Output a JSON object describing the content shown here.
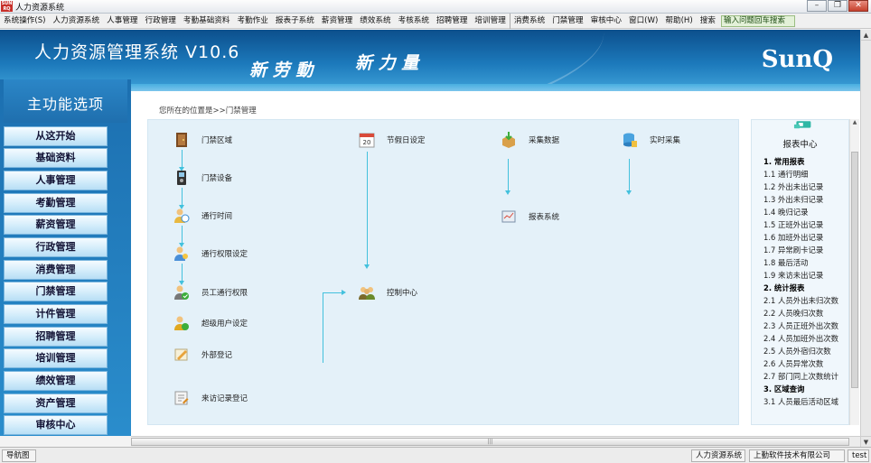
{
  "window": {
    "title": "人力资源系统",
    "icon_text": "SUN RQ"
  },
  "menu": [
    "系统操作(S)",
    "人力资源系统",
    "人事管理",
    "行政管理",
    "考勤基础资料",
    "考勤作业",
    "报表子系统",
    "薪资管理",
    "绩效系统",
    "考核系统",
    "招聘管理",
    "培训管理",
    "消费系统",
    "门禁管理",
    "审核中心",
    "窗口(W)",
    "帮助(H)",
    "搜索"
  ],
  "search": {
    "value": "输入问题回车搜索"
  },
  "banner": {
    "title": "人力资源管理系统 V10.6",
    "slogan1": "新 劳 動",
    "slogan2": "新 力 量",
    "brand": "SunQ"
  },
  "sidebar": {
    "title": "主功能选项",
    "items": [
      "从这开始",
      "基础资料",
      "人事管理",
      "考勤管理",
      "薪资管理",
      "行政管理",
      "消费管理",
      "门禁管理",
      "计件管理",
      "招聘管理",
      "培训管理",
      "绩效管理",
      "资产管理",
      "审核中心"
    ]
  },
  "breadcrumb": "您所在的位置是>>门禁管理",
  "modules": {
    "door_area": "门禁区域",
    "door_device": "门禁设备",
    "pass_time": "通行时间",
    "pass_permission": "通行权限设定",
    "employee_permission": "员工通行权限",
    "super_user": "超级用户设定",
    "visitor_register": "外部登记",
    "visit_record": "来访记录登记",
    "holiday": "节假日设定",
    "control_center": "控制中心",
    "collect_data": "采集数据",
    "report_system": "报表系统",
    "realtime_collect": "实时采集"
  },
  "report_center": {
    "title": "报表中心",
    "items": [
      {
        "text": "1. 常用报表",
        "section": true
      },
      {
        "text": "1.1 通行明细",
        "section": false
      },
      {
        "text": "1.2 外出未出记录",
        "section": false
      },
      {
        "text": "1.3 外出未归记录",
        "section": false
      },
      {
        "text": "1.4 晚归记录",
        "section": false
      },
      {
        "text": "1.5 正班外出记录",
        "section": false
      },
      {
        "text": "1.6 加班外出记录",
        "section": false
      },
      {
        "text": "1.7 异常刷卡记录",
        "section": false
      },
      {
        "text": "1.8 最后活动",
        "section": false
      },
      {
        "text": "1.9 来访未出记录",
        "section": false
      },
      {
        "text": "2. 统计报表",
        "section": true
      },
      {
        "text": "2.1 人员外出未归次数",
        "section": false
      },
      {
        "text": "2.2 人员晚归次数",
        "section": false
      },
      {
        "text": "2.3 人员正班外出次数",
        "section": false
      },
      {
        "text": "2.4 人员加班外出次数",
        "section": false
      },
      {
        "text": "2.5 人员外宿归次数",
        "section": false
      },
      {
        "text": "2.6 人员异常次数",
        "section": false
      },
      {
        "text": "2.7 部门同上次数统计",
        "section": false
      },
      {
        "text": "3. 区域查询",
        "section": true
      },
      {
        "text": "3.1 人员最后活动区域",
        "section": false
      }
    ]
  },
  "status": {
    "nav": "导航图",
    "system": "人力资源系统",
    "company": "上勤软件技术有限公司",
    "user": "test"
  }
}
